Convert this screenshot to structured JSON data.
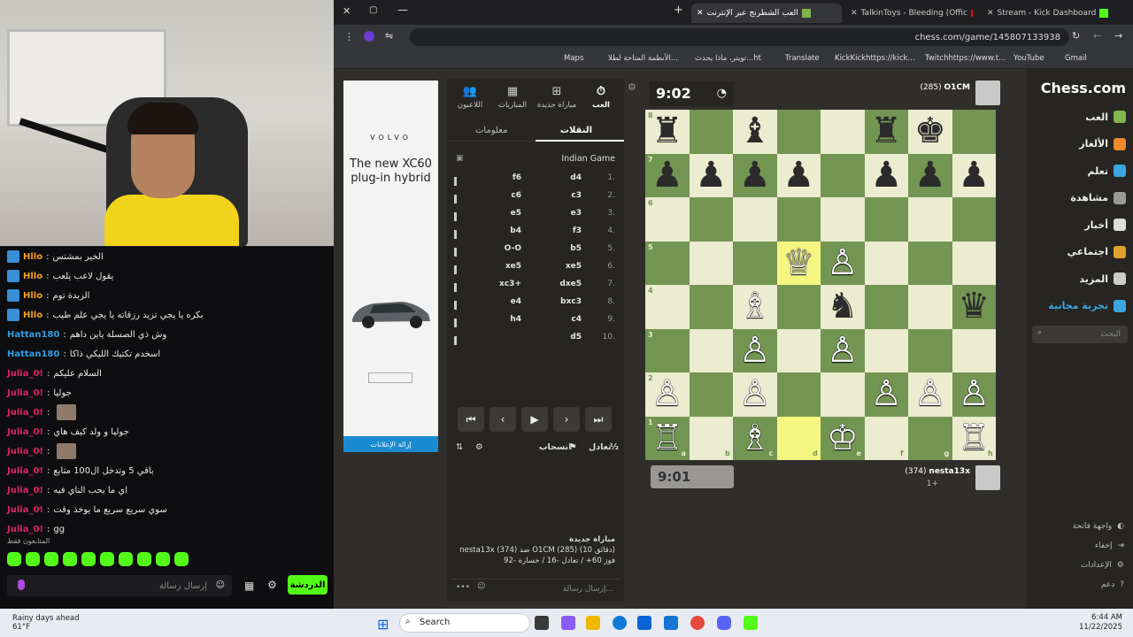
{
  "stream_chat": {
    "messages": [
      {
        "user": "Hllo",
        "text": "الخير بمشتس",
        "color": "#f6a020"
      },
      {
        "user": "Hllo",
        "text": "يقول لاعب يلعب",
        "color": "#f6a020"
      },
      {
        "user": "Hllo",
        "text": "الزبدة توم",
        "color": "#f6a020"
      },
      {
        "user": "Hllo",
        "text": "بكره يا يجي تزيد رزقاته يا يجي علم طيب",
        "color": "#f6a020"
      },
      {
        "user": "Hattan180",
        "text": "وش ذي الصسلة ياين داهم",
        "color": "#2f9de0"
      },
      {
        "user": "Hattan180",
        "text": "اسخدم تكتيك الليكي ذاكا",
        "color": "#2f9de0"
      },
      {
        "user": "Julia_0!",
        "text": "السلام عليكم",
        "color": "#e0206a"
      },
      {
        "user": "Julia_0!",
        "text": "جوليا",
        "color": "#e0206a"
      },
      {
        "user": "Julia_0!",
        "text": "",
        "color": "#e0206a"
      },
      {
        "user": "Julia_0!",
        "text": "جوليا و ولد كيف هاي",
        "color": "#e0206a"
      },
      {
        "user": "Julia_0!",
        "text": "",
        "color": "#e0206a"
      },
      {
        "user": "Julia_0!",
        "text": "باقي 5 وتدخل ال100 متابع",
        "color": "#e0206a"
      },
      {
        "user": "Julia_0!",
        "text": "اي ما يحب الناي فيه",
        "color": "#e0206a"
      },
      {
        "user": "Julia_0!",
        "text": "سوي سريع سريع ما يوخذ وقت",
        "color": "#e0206a"
      },
      {
        "user": "Julia_0!",
        "text": "gg",
        "color": "#e0206a"
      }
    ],
    "followers_only": "المتابعون فقط",
    "input_placeholder": "إرسال رسالة",
    "send_label": "الدردشة"
  },
  "browser": {
    "tabs": [
      {
        "label": "العب الشطرنج عبر الإنترنت",
        "active": true
      },
      {
        "label": "TalkinToys - Bleeding (Offic",
        "active": false
      },
      {
        "label": "Stream - Kick Dashboard",
        "active": false
      }
    ],
    "url": "chess.com/game/145807133938",
    "bookmarks": [
      "Maps",
      "الأنظمة المتاحة لطلا...",
      "تويتر، ماذا يحدث...ht",
      "Translate",
      "KickKickhttps://kick...",
      "Twitchhttps://www.t...",
      "YouTube",
      "Gmail"
    ]
  },
  "ad": {
    "brand": "VOLVO",
    "title": "The new XC60 plug-in hybrid",
    "remove_label": "إزالة الإعلانات"
  },
  "panel": {
    "tabs": [
      "العب",
      "مباراة جديدة",
      "المباريات",
      "اللاعبون"
    ],
    "subtabs": [
      "النقلات",
      "معلومات"
    ],
    "opening": "Indian Game",
    "moves": [
      {
        "n": "1.",
        "w": "d4",
        "b": "f6"
      },
      {
        "n": "2.",
        "w": "c3",
        "b": "c6"
      },
      {
        "n": "3.",
        "w": "e3",
        "b": "e5"
      },
      {
        "n": "4.",
        "w": "f3",
        "b": "b4"
      },
      {
        "n": "5.",
        "w": "b5",
        "b": "O-O"
      },
      {
        "n": "6.",
        "w": "xe5",
        "b": "xe5"
      },
      {
        "n": "7.",
        "w": "dxe5",
        "b": "xc3+"
      },
      {
        "n": "8.",
        "w": "bxc3",
        "b": "e4"
      },
      {
        "n": "9.",
        "w": "c4",
        "b": "h4"
      },
      {
        "n": "10.",
        "w": "d5",
        "b": ""
      }
    ],
    "draw_label": "تعادل",
    "resign_label": "انسحاب",
    "game_info": [
      "مباراة جديدة",
      "nesta13x (374) ضد O1CM (285) (10 دقائق)",
      "فوز 60+ / تعادل -16 / خسارة -92"
    ],
    "chat_placeholder": "إرسال رسالة..."
  },
  "game": {
    "top_player": {
      "name": "O1CM",
      "rating": "(285)"
    },
    "top_clock": "9:02",
    "bottom_player": {
      "name": "nesta13x",
      "rating": "(374)",
      "extra": "1+"
    },
    "bottom_clock": "9:01",
    "light_color": "#ebecd0",
    "dark_color": "#739552",
    "highlight_color": "#f5f682",
    "ranks": [
      "8",
      "7",
      "6",
      "5",
      "4",
      "3",
      "2",
      "1"
    ],
    "files": [
      "a",
      "b",
      "c",
      "d",
      "e",
      "f",
      "g",
      "h"
    ],
    "pieces": [
      {
        "sq": "a8",
        "p": "♜",
        "c": "b"
      },
      {
        "sq": "c8",
        "p": "♝",
        "c": "b"
      },
      {
        "sq": "f8",
        "p": "♜",
        "c": "b"
      },
      {
        "sq": "g8",
        "p": "♚",
        "c": "b"
      },
      {
        "sq": "a7",
        "p": "♟",
        "c": "b"
      },
      {
        "sq": "b7",
        "p": "♟",
        "c": "b"
      },
      {
        "sq": "c7",
        "p": "♟",
        "c": "b"
      },
      {
        "sq": "d7",
        "p": "♟",
        "c": "b"
      },
      {
        "sq": "f7",
        "p": "♟",
        "c": "b"
      },
      {
        "sq": "g7",
        "p": "♟",
        "c": "b"
      },
      {
        "sq": "h7",
        "p": "♟",
        "c": "b"
      },
      {
        "sq": "d5",
        "p": "♕",
        "c": "w"
      },
      {
        "sq": "e5",
        "p": "♙",
        "c": "w"
      },
      {
        "sq": "c4",
        "p": "♗",
        "c": "w"
      },
      {
        "sq": "e4",
        "p": "♞",
        "c": "b"
      },
      {
        "sq": "h4",
        "p": "♛",
        "c": "b"
      },
      {
        "sq": "c3",
        "p": "♙",
        "c": "w"
      },
      {
        "sq": "e3",
        "p": "♙",
        "c": "w"
      },
      {
        "sq": "a2",
        "p": "♙",
        "c": "w"
      },
      {
        "sq": "c2",
        "p": "♙",
        "c": "w"
      },
      {
        "sq": "f2",
        "p": "♙",
        "c": "w"
      },
      {
        "sq": "g2",
        "p": "♙",
        "c": "w"
      },
      {
        "sq": "h2",
        "p": "♙",
        "c": "w"
      },
      {
        "sq": "a1",
        "p": "♖",
        "c": "w"
      },
      {
        "sq": "c1",
        "p": "♗",
        "c": "w"
      },
      {
        "sq": "e1",
        "p": "♔",
        "c": "w"
      },
      {
        "sq": "h1",
        "p": "♖",
        "c": "w"
      }
    ],
    "highlights": [
      "d5",
      "d1"
    ]
  },
  "nav": {
    "logo": "Chess.com",
    "items": [
      "العب",
      "الألغاز",
      "تعلم",
      "مشاهدة",
      "أخبار",
      "اجتماعي",
      "المزيد",
      "تجربة مجانية"
    ],
    "search_placeholder": "البحث",
    "footer": [
      "واجهة فاتحة",
      "إخفاء",
      "الإعدادات",
      "دعم"
    ]
  },
  "taskbar": {
    "weather_title": "Rainy days ahead",
    "weather_temp": "61°F",
    "search_label": "Search",
    "time": "6:44 AM",
    "date": "11/22/2025"
  }
}
